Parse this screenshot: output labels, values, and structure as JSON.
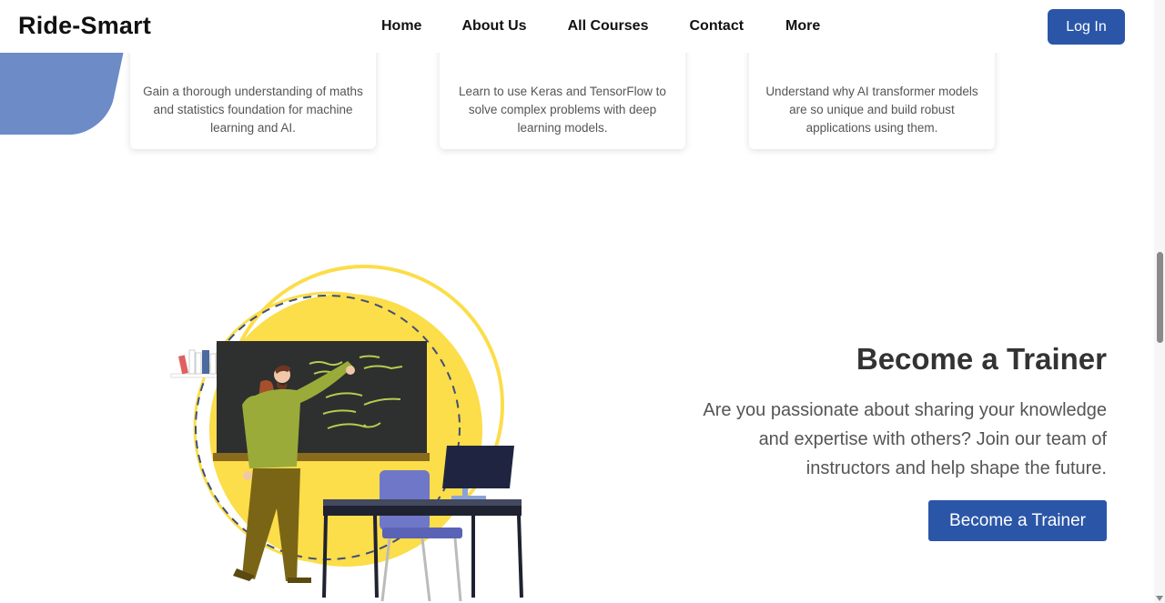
{
  "header": {
    "logo": "Ride-Smart",
    "nav": [
      {
        "label": "Home"
      },
      {
        "label": "About Us"
      },
      {
        "label": "All Courses"
      },
      {
        "label": "Contact"
      },
      {
        "label": "More"
      }
    ],
    "login_label": "Log In"
  },
  "courses": [
    {
      "description": "Gain a thorough understanding of maths and statistics foundation for machine learning and AI."
    },
    {
      "description": "Learn to use Keras and TensorFlow to solve complex problems with deep learning models."
    },
    {
      "description": "Understand why AI transformer models are so unique and build robust applications using them."
    }
  ],
  "trainer": {
    "title": "Become a Trainer",
    "text": "Are you passionate about sharing your knowledge and expertise with others? Join our team of instructors and help shape the future.",
    "button_label": "Become a Trainer"
  },
  "colors": {
    "primary": "#2b56a8",
    "accent_yellow": "#fcdd4a",
    "blob_blue": "#6c8bc7"
  }
}
